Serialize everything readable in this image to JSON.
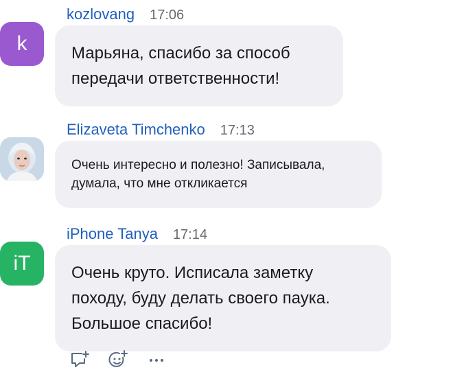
{
  "messages": [
    {
      "sender": "kozlovang",
      "time": "17:06",
      "avatar_text": "k",
      "avatar_color": "#9b59d0",
      "text": "Марьяна, спасибо за способ\nпередачи ответственности!"
    },
    {
      "sender": "Elizaveta Timchenko",
      "time": "17:13",
      "avatar_text": "",
      "text": "Очень интересно и полезно! Записывала,\nдумала, что мне откликается"
    },
    {
      "sender": "iPhone Tanya",
      "time": "17:14",
      "avatar_text": "iT",
      "avatar_color": "#27b364",
      "text": "Очень круто. Исписала заметку\nпоходу, буду делать своего паука.\nБольшое спасибо!"
    }
  ],
  "actions": [
    {
      "icon": "reply-icon"
    },
    {
      "icon": "add-reaction-icon"
    },
    {
      "icon": "more-icon"
    }
  ],
  "colors": {
    "name": "#1f5fbf",
    "bubble": "#f0f0f4",
    "icon": "#5a6a80"
  }
}
